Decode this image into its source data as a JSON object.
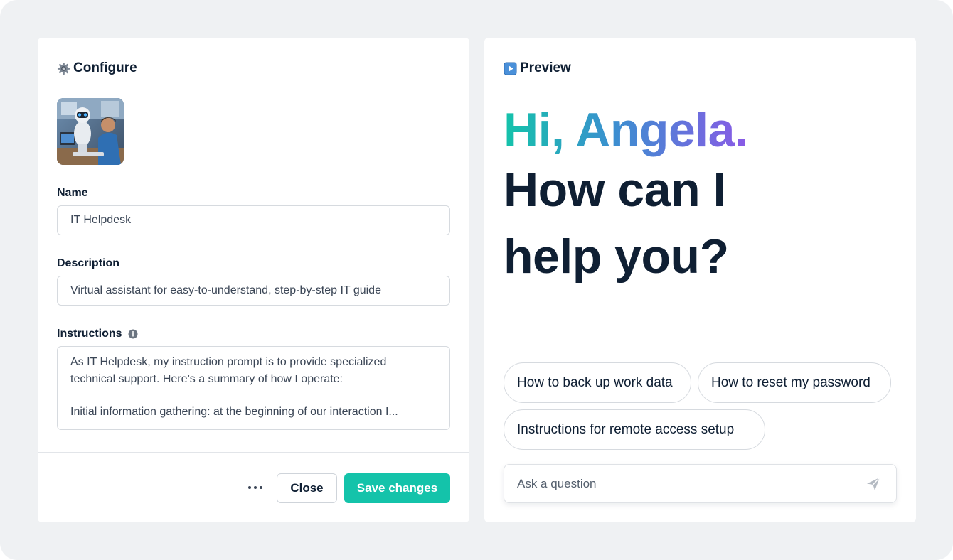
{
  "configure": {
    "title": "Configure",
    "name_label": "Name",
    "name_value": "IT Helpdesk",
    "description_label": "Description",
    "description_value": "Virtual assistant for easy-to-understand, step-by-step IT guide",
    "instructions_label": "Instructions",
    "instructions_lines": [
      "As IT Helpdesk, my instruction prompt is to provide specialized",
      "technical support. Here’s a summary of how I operate:",
      "",
      "Initial information gathering: at the beginning of our interaction I..."
    ],
    "close_label": "Close",
    "save_label": "Save changes"
  },
  "preview": {
    "title": "Preview",
    "greeting": "Hi, Angela.",
    "headline_line1": "How can I",
    "headline_line2": "help you?",
    "suggestions": [
      "How to back up work data",
      "How to reset my password",
      "Instructions for remote access setup"
    ],
    "ask_placeholder": "Ask a question"
  },
  "icons": {
    "configure": "gear-icon",
    "preview": "play-icon",
    "info": "info-icon",
    "more": "more-horizontal-icon",
    "send": "send-icon"
  },
  "colors": {
    "accent": "#14c3aa",
    "gradient_start": "#14c3aa",
    "gradient_mid": "#3b8fd0",
    "gradient_end": "#8a5ae6",
    "text": "#0f1f33",
    "background": "#eff1f3"
  }
}
